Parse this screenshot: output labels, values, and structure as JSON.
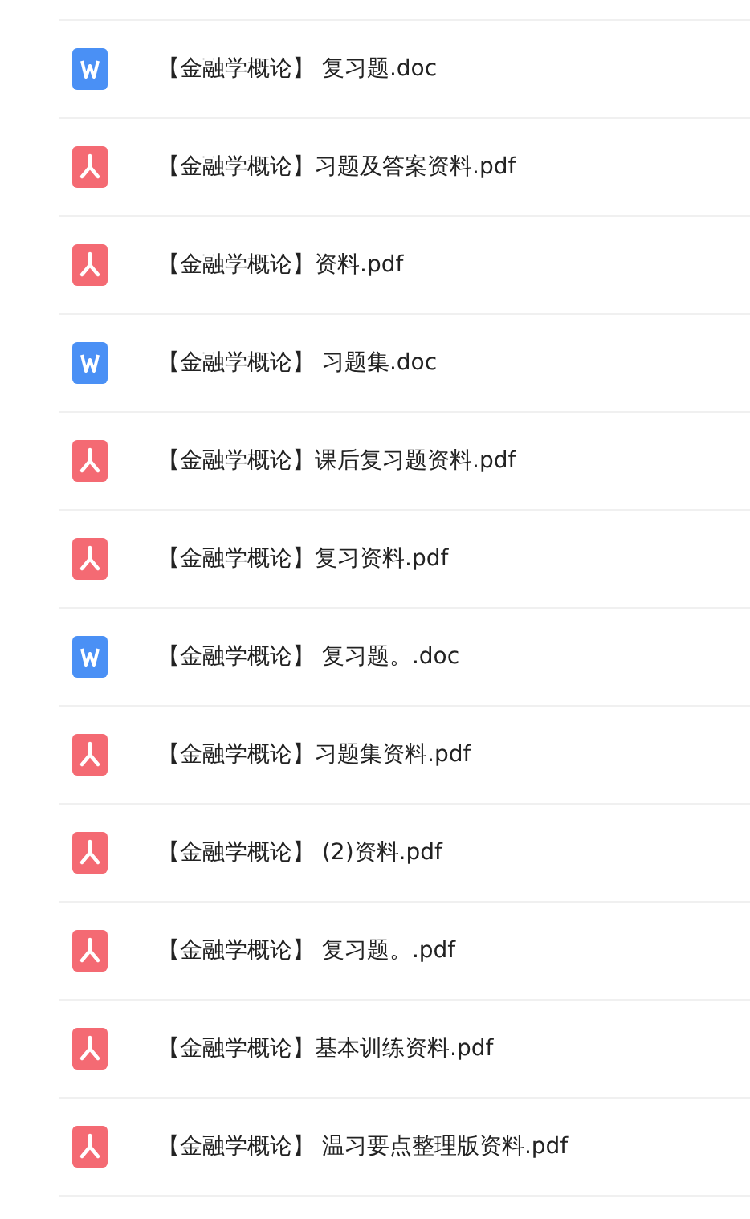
{
  "files": [
    {
      "kind": "word",
      "name": "【金融学概论】 复习题.doc"
    },
    {
      "kind": "pdf",
      "name": "【金融学概论】习题及答案资料.pdf"
    },
    {
      "kind": "pdf",
      "name": "【金融学概论】资料.pdf"
    },
    {
      "kind": "word",
      "name": "【金融学概论】 习题集.doc"
    },
    {
      "kind": "pdf",
      "name": "【金融学概论】课后复习题资料.pdf"
    },
    {
      "kind": "pdf",
      "name": "【金融学概论】复习资料.pdf"
    },
    {
      "kind": "word",
      "name": "【金融学概论】 复习题。.doc"
    },
    {
      "kind": "pdf",
      "name": "【金融学概论】习题集资料.pdf"
    },
    {
      "kind": "pdf",
      "name": "【金融学概论】 (2)资料.pdf"
    },
    {
      "kind": "pdf",
      "name": "【金融学概论】 复习题。.pdf"
    },
    {
      "kind": "pdf",
      "name": "【金融学概论】基本训练资料.pdf"
    },
    {
      "kind": "pdf",
      "name": "【金融学概论】 温习要点整理版资料.pdf"
    }
  ]
}
